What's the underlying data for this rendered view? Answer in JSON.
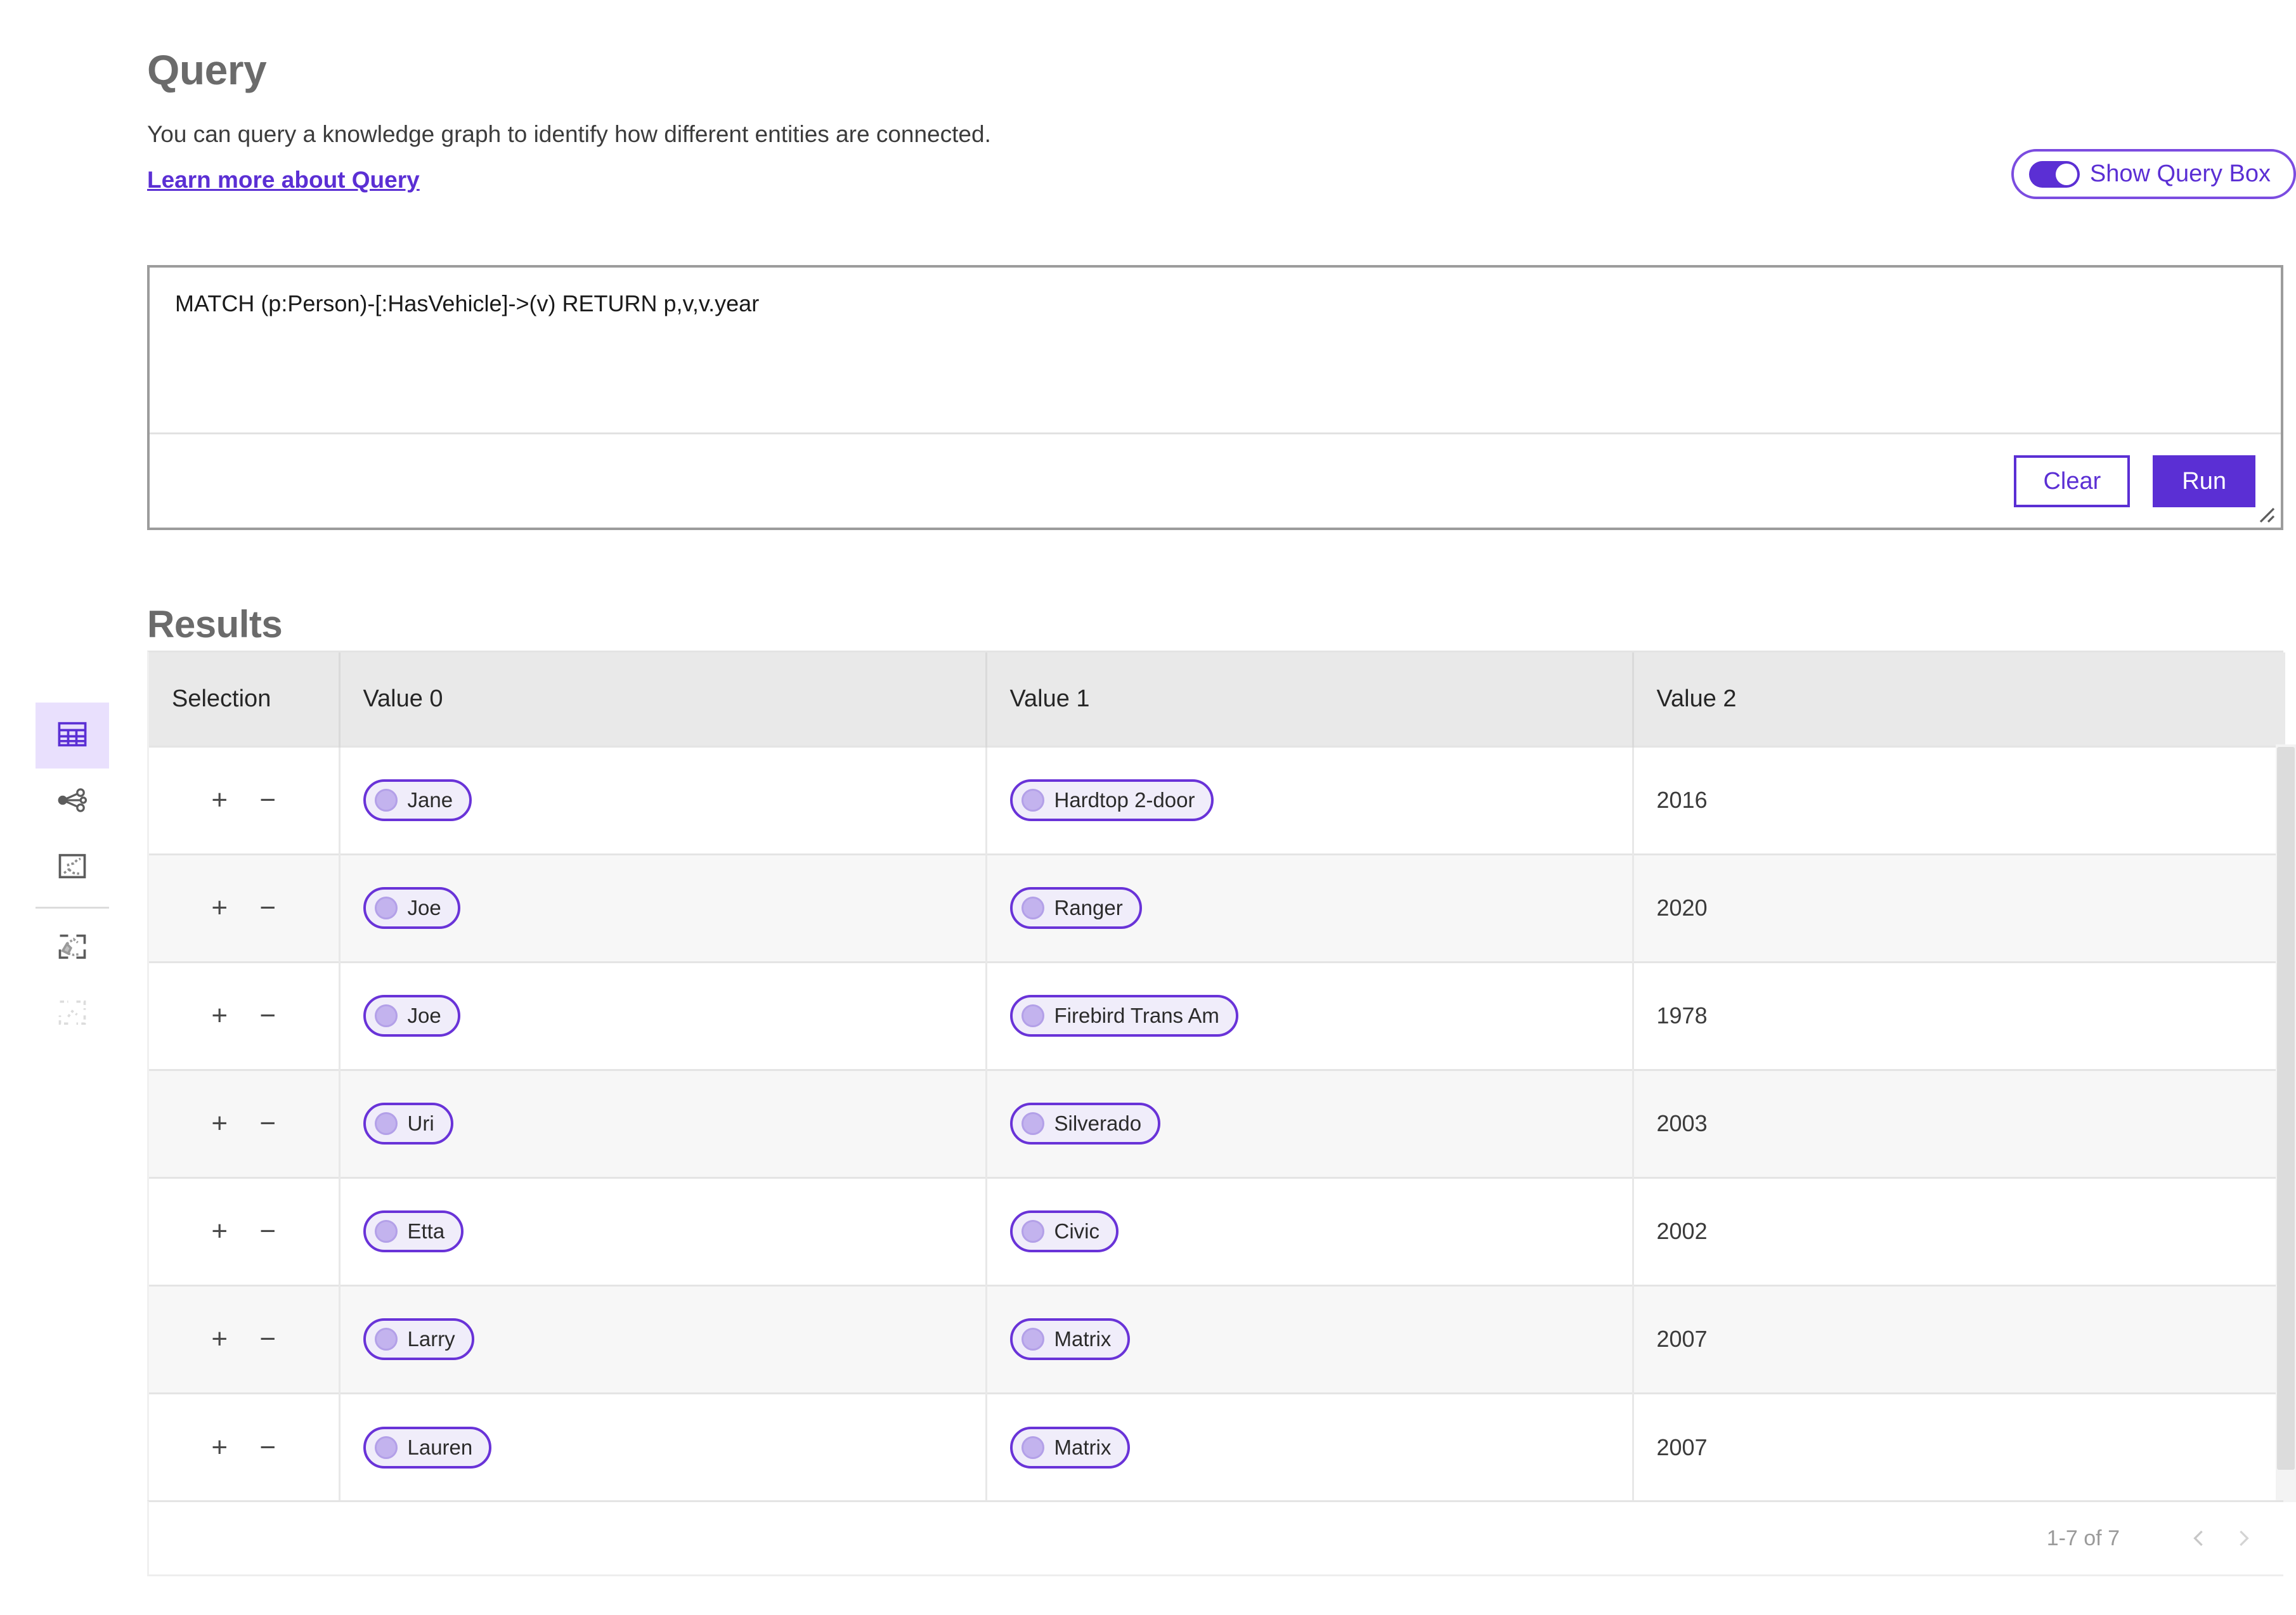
{
  "header": {
    "title": "Query",
    "subtitle": "You can query a knowledge graph to identify how different entities are connected.",
    "learn_more": "Learn more about Query"
  },
  "toggle": {
    "label": "Show Query Box",
    "state": "on",
    "accent": "#5b2fd4"
  },
  "query": {
    "value": "MATCH (p:Person)-[:HasVehicle]->(v) RETURN p,v,v.year",
    "placeholder": "",
    "clear_label": "Clear",
    "run_label": "Run"
  },
  "results": {
    "title": "Results",
    "columns": [
      "Selection",
      "Value 0",
      "Value 1",
      "Value 2"
    ],
    "selection_add": "+",
    "selection_remove": "−",
    "rows": [
      {
        "value0": "Jane",
        "value1": "Hardtop 2-door",
        "value2": "2016"
      },
      {
        "value0": "Joe",
        "value1": "Ranger",
        "value2": "2020"
      },
      {
        "value0": "Joe",
        "value1": "Firebird Trans Am",
        "value2": "1978"
      },
      {
        "value0": "Uri",
        "value1": "Silverado",
        "value2": "2003"
      },
      {
        "value0": "Etta",
        "value1": "Civic",
        "value2": "2002"
      },
      {
        "value0": "Larry",
        "value1": "Matrix",
        "value2": "2007"
      },
      {
        "value0": "Lauren",
        "value1": "Matrix",
        "value2": "2007"
      }
    ],
    "pagination": {
      "count_label": "1-7 of 7",
      "prev_icon": "chevron-left-icon",
      "next_icon": "chevron-right-icon"
    }
  },
  "sidebar": {
    "items": [
      {
        "icon": "table-view-icon",
        "active": true
      },
      {
        "icon": "graph-view-icon",
        "active": false
      },
      {
        "icon": "map-route-icon",
        "active": false
      },
      {
        "icon": "map-selection-icon",
        "active": false
      },
      {
        "icon": "map-empty-icon",
        "active": false
      }
    ]
  },
  "colors": {
    "accent": "#5b2fd4",
    "chip_border": "#6933d8",
    "chip_fill": "#f0edfa",
    "rail_active_bg": "#e9e0fd",
    "header_bg": "#e9e9e9"
  }
}
